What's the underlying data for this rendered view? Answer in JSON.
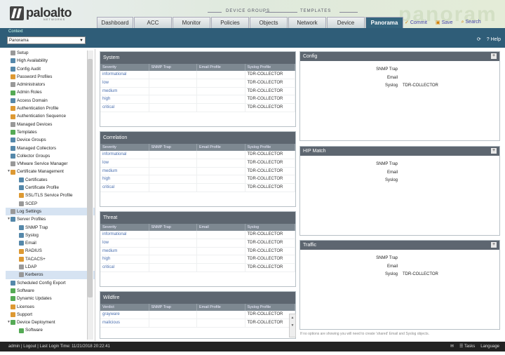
{
  "header": {
    "logo": "paloalto",
    "logo_sub": "NETWORKS",
    "group_device": "DEVICE GROUPS",
    "group_templates": "TEMPLATES",
    "tabs": [
      "Dashboard",
      "ACC",
      "Monitor",
      "Policies",
      "Objects",
      "Network",
      "Device",
      "Panorama"
    ],
    "active_tab": "Panorama",
    "actions": [
      {
        "label": "Commit",
        "icon": "commit-icon"
      },
      {
        "label": "Save",
        "icon": "save-icon"
      },
      {
        "label": "Search",
        "icon": "search-icon"
      }
    ]
  },
  "context": {
    "label": "Context",
    "value": "Panorama"
  },
  "subbar": {
    "help": "Help"
  },
  "sidebar": [
    {
      "label": "Setup",
      "indent": 0,
      "icon": "gray"
    },
    {
      "label": "High Availability",
      "indent": 0,
      "icon": "blue"
    },
    {
      "label": "Config Audit",
      "indent": 0,
      "icon": "blue"
    },
    {
      "label": "Password Profiles",
      "indent": 0,
      "icon": "orange"
    },
    {
      "label": "Administrators",
      "indent": 0,
      "icon": "gray"
    },
    {
      "label": "Admin Roles",
      "indent": 0,
      "icon": "green"
    },
    {
      "label": "Access Domain",
      "indent": 0,
      "icon": "blue"
    },
    {
      "label": "Authentication Profile",
      "indent": 0,
      "icon": "orange"
    },
    {
      "label": "Authentication Sequence",
      "indent": 0,
      "icon": "orange"
    },
    {
      "label": "Managed Devices",
      "indent": 0,
      "icon": "gray"
    },
    {
      "label": "Templates",
      "indent": 0,
      "icon": "green"
    },
    {
      "label": "Device Groups",
      "indent": 0,
      "icon": "blue"
    },
    {
      "label": "Managed Collectors",
      "indent": 0,
      "icon": "blue"
    },
    {
      "label": "Collector Groups",
      "indent": 0,
      "icon": "blue"
    },
    {
      "label": "VMware Service Manager",
      "indent": 0,
      "icon": "gray"
    },
    {
      "label": "Certificate Management",
      "indent": 0,
      "icon": "orange",
      "caret": true
    },
    {
      "label": "Certificates",
      "indent": 1,
      "icon": "blue"
    },
    {
      "label": "Certificate Profile",
      "indent": 1,
      "icon": "blue"
    },
    {
      "label": "SSL/TLS Service Profile",
      "indent": 1,
      "icon": "orange"
    },
    {
      "label": "SCEP",
      "indent": 1,
      "icon": "gray"
    },
    {
      "label": "Log Settings",
      "indent": 0,
      "icon": "gray",
      "selected": true
    },
    {
      "label": "Server Profiles",
      "indent": 0,
      "icon": "blue",
      "caret": true
    },
    {
      "label": "SNMP Trap",
      "indent": 1,
      "icon": "blue"
    },
    {
      "label": "Syslog",
      "indent": 1,
      "icon": "blue"
    },
    {
      "label": "Email",
      "indent": 1,
      "icon": "blue"
    },
    {
      "label": "RADIUS",
      "indent": 1,
      "icon": "orange"
    },
    {
      "label": "TACACS+",
      "indent": 1,
      "icon": "orange"
    },
    {
      "label": "LDAP",
      "indent": 1,
      "icon": "gray"
    },
    {
      "label": "Kerberos",
      "indent": 1,
      "icon": "gray",
      "selected": true
    },
    {
      "label": "Scheduled Config Export",
      "indent": 0,
      "icon": "blue"
    },
    {
      "label": "Software",
      "indent": 0,
      "icon": "green"
    },
    {
      "label": "Dynamic Updates",
      "indent": 0,
      "icon": "green"
    },
    {
      "label": "Licenses",
      "indent": 0,
      "icon": "orange"
    },
    {
      "label": "Support",
      "indent": 0,
      "icon": "orange"
    },
    {
      "label": "Device Deployment",
      "indent": 0,
      "icon": "green",
      "caret": true
    },
    {
      "label": "Software",
      "indent": 1,
      "icon": "green"
    }
  ],
  "panels": [
    {
      "title": "System",
      "headers": [
        "Severity",
        "SNMP Trap",
        "Email Profile",
        "Syslog Profile"
      ],
      "rows": [
        [
          "informational",
          "",
          "",
          "TDR-COLLECTOR"
        ],
        [
          "low",
          "",
          "",
          "TDR-COLLECTOR"
        ],
        [
          "medium",
          "",
          "",
          "TDR-COLLECTOR"
        ],
        [
          "high",
          "",
          "",
          "TDR-COLLECTOR"
        ],
        [
          "critical",
          "",
          "",
          "TDR-COLLECTOR"
        ]
      ]
    },
    {
      "title": "Correlation",
      "headers": [
        "Severity",
        "SNMP Trap",
        "Email Profile",
        "Syslog Profile"
      ],
      "rows": [
        [
          "informational",
          "",
          "",
          "TDR-COLLECTOR"
        ],
        [
          "low",
          "",
          "",
          "TDR-COLLECTOR"
        ],
        [
          "medium",
          "",
          "",
          "TDR-COLLECTOR"
        ],
        [
          "high",
          "",
          "",
          "TDR-COLLECTOR"
        ],
        [
          "critical",
          "",
          "",
          "TDR-COLLECTOR"
        ]
      ]
    },
    {
      "title": "Threat",
      "headers": [
        "Severity",
        "SNMP Trap",
        "Email",
        "Syslog"
      ],
      "rows": [
        [
          "informational",
          "",
          "",
          "TDR-COLLECTOR"
        ],
        [
          "low",
          "",
          "",
          "TDR-COLLECTOR"
        ],
        [
          "medium",
          "",
          "",
          "TDR-COLLECTOR"
        ],
        [
          "high",
          "",
          "",
          "TDR-COLLECTOR"
        ],
        [
          "critical",
          "",
          "",
          "TDR-COLLECTOR"
        ]
      ]
    },
    {
      "title": "Wildfire",
      "headers": [
        "Verdict",
        "SNMP Trap",
        "Email Profile",
        "Syslog Profile"
      ],
      "rows": [
        [
          "grayware",
          "",
          "",
          "TDR-COLLECTOR"
        ],
        [
          "malicious",
          "",
          "",
          "TDR-COLLECTOR"
        ]
      ]
    }
  ],
  "right_panels": [
    {
      "title": "Config",
      "fields": [
        {
          "k": "SNMP Trap",
          "v": ""
        },
        {
          "k": "Email",
          "v": ""
        },
        {
          "k": "Syslog",
          "v": "TDR-COLLECTOR"
        }
      ]
    },
    {
      "title": "HIP Match",
      "fields": [
        {
          "k": "SNMP Trap",
          "v": ""
        },
        {
          "k": "Email",
          "v": ""
        },
        {
          "k": "Syslog",
          "v": ""
        }
      ]
    },
    {
      "title": "Traffic",
      "fields": [
        {
          "k": "SNMP Trap",
          "v": ""
        },
        {
          "k": "Email",
          "v": ""
        },
        {
          "k": "Syslog",
          "v": "TDR-COLLECTOR"
        }
      ]
    }
  ],
  "footnote": "If no options are showing you will need to create 'shared' Email and Syslog objects.",
  "status": {
    "left": "admin | Logout | Last Login Time: 11/21/2018 20:22:41",
    "tasks": "Tasks",
    "language": "Language"
  }
}
